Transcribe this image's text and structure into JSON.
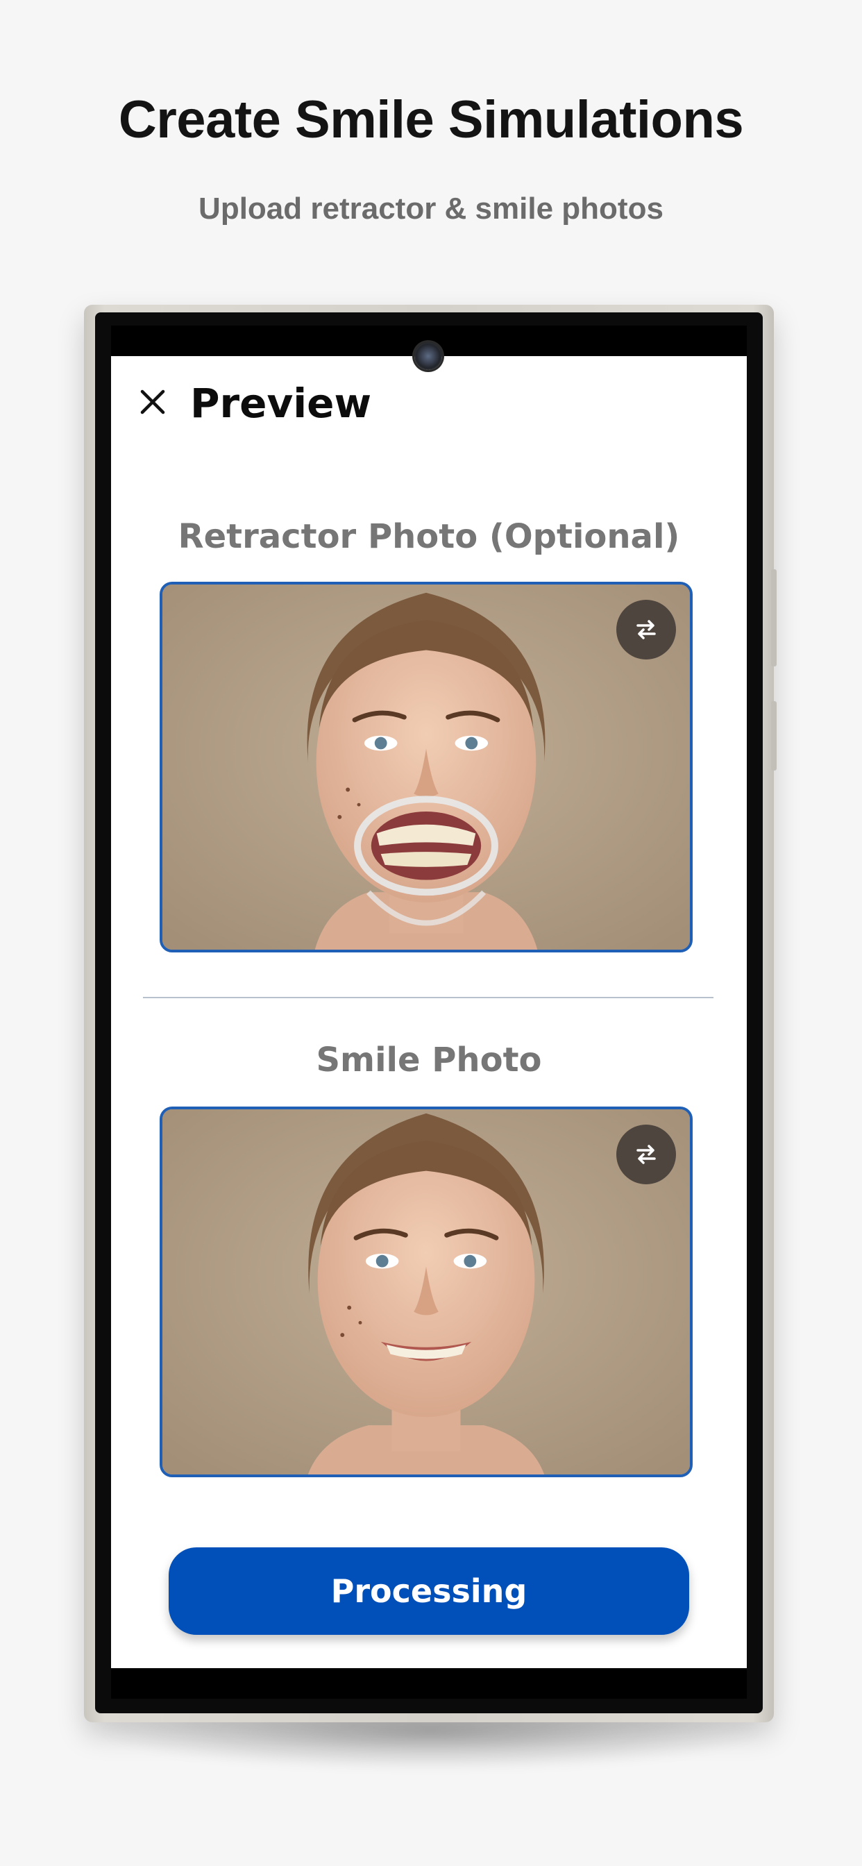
{
  "hero": {
    "title": "Create Smile Simulations",
    "subtitle": "Upload retractor & smile photos"
  },
  "app": {
    "header": {
      "close_icon": "close-icon",
      "title": "Preview"
    },
    "retractor_section": {
      "label": "Retractor Photo (Optional)",
      "swap_icon": "swap-arrows-icon"
    },
    "smile_section": {
      "label": "Smile Photo",
      "swap_icon": "swap-arrows-icon"
    },
    "primary_button": {
      "label": "Processing"
    }
  },
  "colors": {
    "accent": "#0150b9",
    "card_border": "#1f5fb6",
    "swap_button_bg": "#4e453e",
    "section_label": "#767676",
    "page_background": "#f6f6f6"
  }
}
